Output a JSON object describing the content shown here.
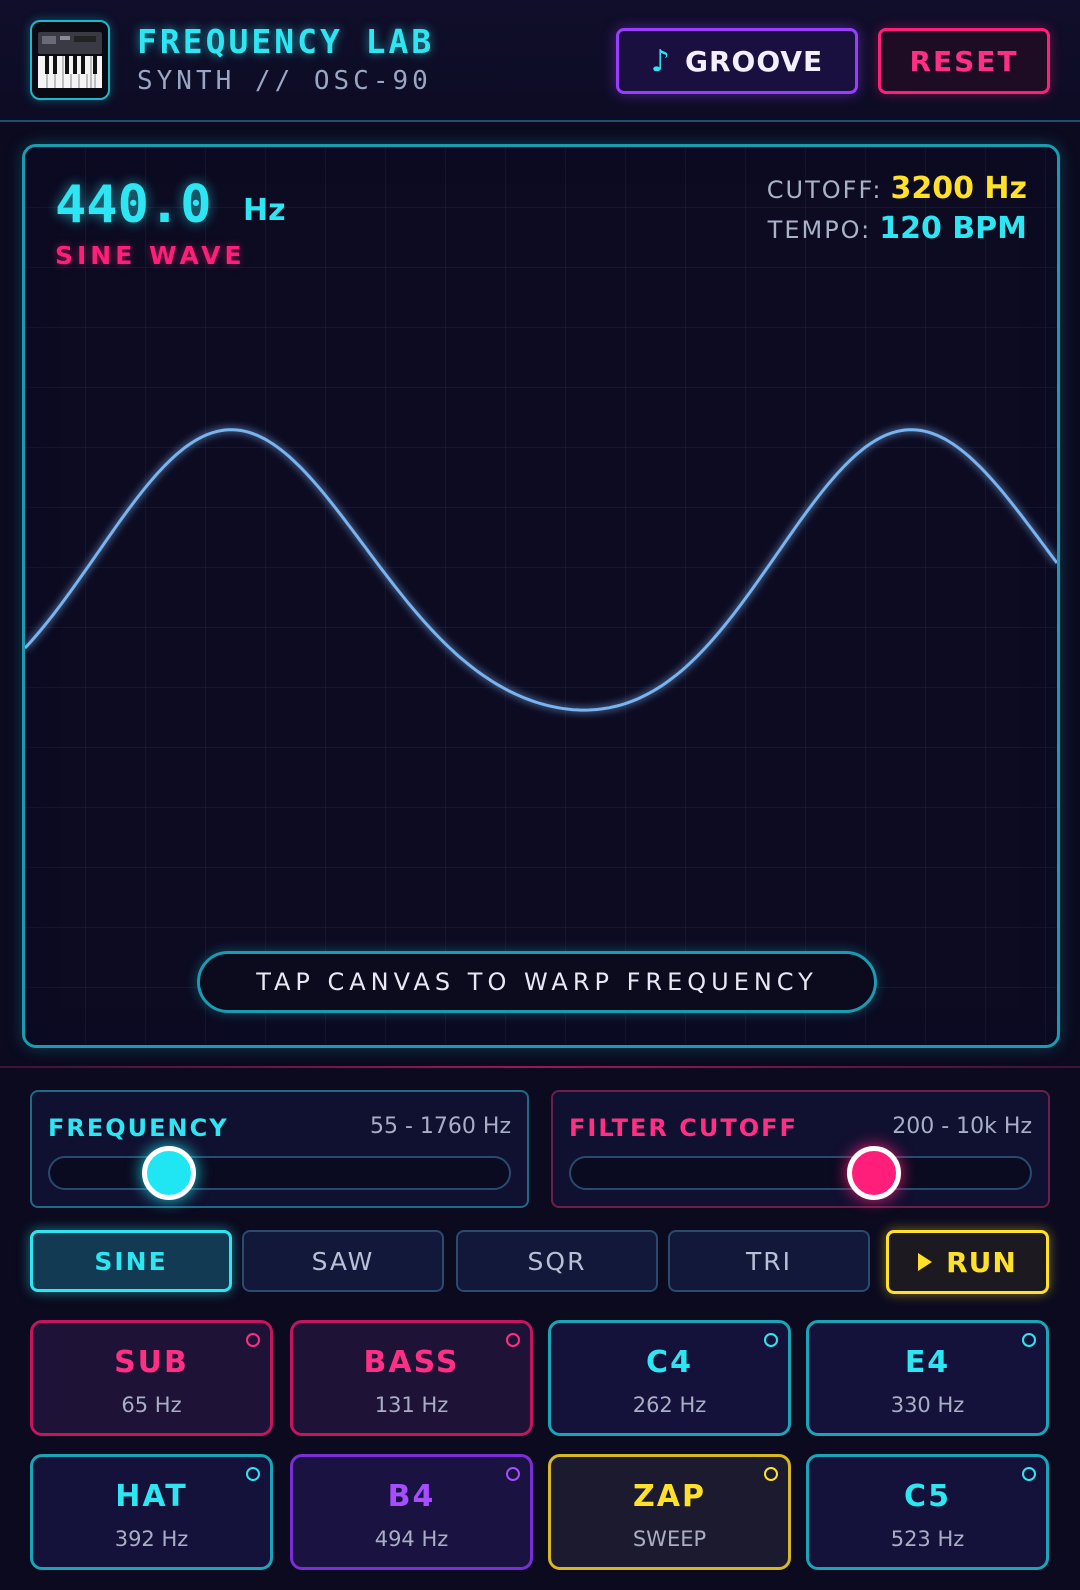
{
  "header": {
    "title": "FREQUENCY LAB",
    "subtitle": "SYNTH // OSC-90",
    "groove_label": "GROOVE",
    "reset_label": "RESET"
  },
  "scope": {
    "frequency_value": "440.0",
    "frequency_unit": "Hz",
    "wave_name": "SINE WAVE",
    "cutoff_label": "CUTOFF:",
    "cutoff_value": "3200 Hz",
    "tempo_label": "TEMPO:",
    "tempo_value": "120 BPM",
    "hint": "TAP CANVAS TO WARP FREQUENCY"
  },
  "sliders": {
    "frequency": {
      "label": "FREQUENCY",
      "range": "55 - 1760 Hz",
      "level": 0.26
    },
    "filter": {
      "label": "FILTER CUTOFF",
      "range": "200 - 10k Hz",
      "level": 0.66
    }
  },
  "waveforms": {
    "items": [
      {
        "label": "SINE",
        "active": true
      },
      {
        "label": "SAW",
        "active": false
      },
      {
        "label": "SQR",
        "active": false
      },
      {
        "label": "TRI",
        "active": false
      }
    ],
    "run_label": "RUN"
  },
  "pads": [
    {
      "name": "SUB",
      "sub": "65 Hz",
      "color": "#ff2f85"
    },
    {
      "name": "BASS",
      "sub": "131 Hz",
      "color": "#ff2f85"
    },
    {
      "name": "C4",
      "sub": "262 Hz",
      "color": "#2ee6f2"
    },
    {
      "name": "E4",
      "sub": "330 Hz",
      "color": "#2ee6f2"
    },
    {
      "name": "HAT",
      "sub": "392 Hz",
      "color": "#2ee6f2"
    },
    {
      "name": "B4",
      "sub": "494 Hz",
      "color": "#a64dff"
    },
    {
      "name": "ZAP",
      "sub": "SWEEP",
      "color": "#ffe12a"
    },
    {
      "name": "C5",
      "sub": "523 Hz",
      "color": "#2ee6f2"
    }
  ],
  "colors": {
    "cyan": "#2ee6f2",
    "pink": "#ff1f7a",
    "yellow": "#ffe12a",
    "violet": "#9a3dff",
    "background": "#0b0a1f"
  },
  "icons": {
    "logo": "synth-keyboard-icon",
    "groove": "music-note-icon",
    "run": "play-icon"
  }
}
